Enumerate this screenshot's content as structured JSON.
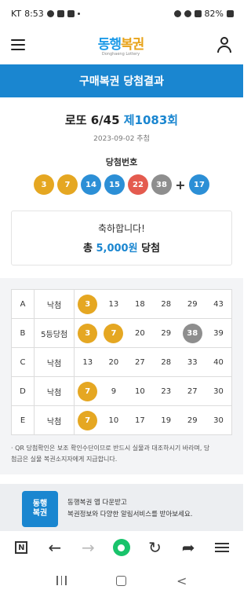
{
  "status_bar": {
    "carrier": "KT",
    "time": "8:53",
    "battery": "82%"
  },
  "header": {
    "logo_part1": "동행",
    "logo_part2": "복권",
    "logo_sub": "Donghaeng Lottery",
    "menu_icon": "hamburger-icon",
    "account_icon": "person-icon"
  },
  "title_bar": "구매복권 당첨결과",
  "result": {
    "game_name": "로또 6/45",
    "draw_no": "제1083회",
    "draw_date": "2023-09-02 추첨",
    "numbers_label": "당첨번호",
    "numbers": [
      "3",
      "7",
      "14",
      "15",
      "22",
      "38"
    ],
    "plus": "+",
    "bonus": "17",
    "congrats": "축하합니다!",
    "prize_prefix": "총",
    "prize_amount": "5,000원",
    "prize_suffix": "당첨"
  },
  "ball_colors": {
    "yellow": "#e5a722",
    "blue": "#2c8fd6",
    "red": "#e45b4f",
    "gray": "#8e8e8e"
  },
  "tickets": [
    {
      "letter": "A",
      "result": "낙첨",
      "nums": [
        "3",
        "13",
        "18",
        "28",
        "29",
        "43"
      ],
      "hit_colors": [
        "#e5a722",
        null,
        null,
        null,
        null,
        null
      ]
    },
    {
      "letter": "B",
      "result": "5등당첨",
      "nums": [
        "3",
        "7",
        "20",
        "29",
        "38",
        "39"
      ],
      "hit_colors": [
        "#e5a722",
        "#e5a722",
        null,
        null,
        "#8e8e8e",
        null
      ]
    },
    {
      "letter": "C",
      "result": "낙첨",
      "nums": [
        "13",
        "20",
        "27",
        "28",
        "33",
        "40"
      ],
      "hit_colors": [
        null,
        null,
        null,
        null,
        null,
        null
      ]
    },
    {
      "letter": "D",
      "result": "낙첨",
      "nums": [
        "7",
        "9",
        "10",
        "23",
        "27",
        "30"
      ],
      "hit_colors": [
        "#e5a722",
        null,
        null,
        null,
        null,
        null
      ]
    },
    {
      "letter": "E",
      "result": "낙첨",
      "nums": [
        "7",
        "10",
        "17",
        "19",
        "29",
        "30"
      ],
      "hit_colors": [
        "#e5a722",
        null,
        null,
        null,
        null,
        null
      ]
    }
  ],
  "note_line1": "· QR 당첨확인은 보조 확인수단이므로 반드시 실물과 대조하시기 바라며, 당",
  "note_line2": "첨금은 실물 복권소지자에게 지급합니다.",
  "banner": {
    "logo_line1": "동행",
    "logo_line2": "복권",
    "line1": "동행복권 앱 다운받고",
    "line2": "복권정보와 다양한 알림서비스를 받아보세요."
  },
  "browser": {
    "n_label": "N"
  }
}
